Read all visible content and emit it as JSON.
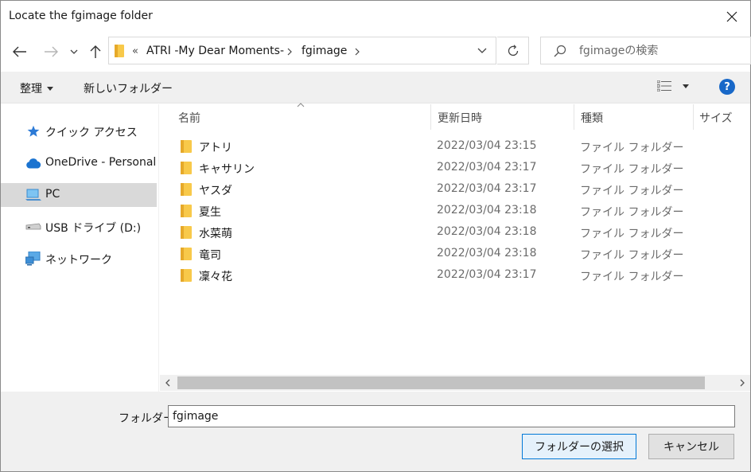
{
  "window": {
    "title": "Locate the fgimage folder"
  },
  "nav": {
    "breadcrumbs": [
      {
        "label": "ATRI -My Dear Moments-"
      },
      {
        "label": "fgimage"
      }
    ],
    "overflow_glyph": "«",
    "search_placeholder": "fgimageの検索"
  },
  "toolbar": {
    "organize_label": "整理",
    "new_folder_label": "新しいフォルダー",
    "help_label": "?"
  },
  "sidebar": {
    "items": [
      {
        "label": "クイック アクセス",
        "icon": "star-icon"
      },
      {
        "label": "OneDrive - Personal",
        "icon": "cloud-icon"
      },
      {
        "label": "PC",
        "icon": "pc-icon",
        "selected": true
      },
      {
        "label": "USB ドライブ (D:)",
        "icon": "usb-drive-icon"
      },
      {
        "label": "ネットワーク",
        "icon": "network-icon"
      }
    ]
  },
  "columns": {
    "name": "名前",
    "date": "更新日時",
    "type": "種類",
    "size": "サイズ"
  },
  "files": [
    {
      "name": "アトリ",
      "date": "2022/03/04 23:15",
      "type": "ファイル フォルダー"
    },
    {
      "name": "キャサリン",
      "date": "2022/03/04 23:17",
      "type": "ファイル フォルダー"
    },
    {
      "name": "ヤスダ",
      "date": "2022/03/04 23:17",
      "type": "ファイル フォルダー"
    },
    {
      "name": "夏生",
      "date": "2022/03/04 23:18",
      "type": "ファイル フォルダー"
    },
    {
      "name": "水菜萌",
      "date": "2022/03/04 23:18",
      "type": "ファイル フォルダー"
    },
    {
      "name": "竜司",
      "date": "2022/03/04 23:18",
      "type": "ファイル フォルダー"
    },
    {
      "name": "凜々花",
      "date": "2022/03/04 23:17",
      "type": "ファイル フォルダー"
    }
  ],
  "footer": {
    "folder_label": "フォルダー:",
    "folder_value": "fgimage",
    "select_label": "フォルダーの選択",
    "cancel_label": "キャンセル"
  },
  "colors": {
    "accent": "#0078d7",
    "folder": "#f8c94a",
    "selected_bg": "#d9d9d9"
  }
}
